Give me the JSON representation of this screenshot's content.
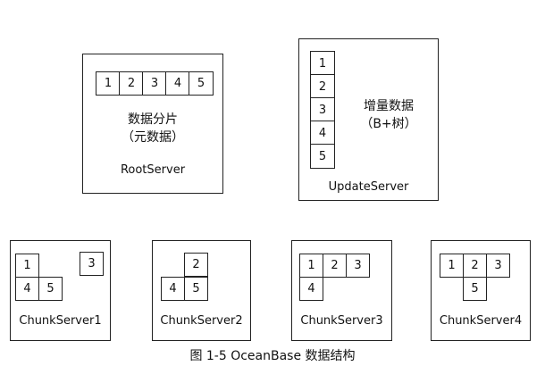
{
  "root_server": {
    "cells": [
      "1",
      "2",
      "3",
      "4",
      "5"
    ],
    "desc_line1": "数据分片",
    "desc_line2": "（元数据）",
    "label": "RootServer"
  },
  "update_server": {
    "cells": [
      "1",
      "2",
      "3",
      "4",
      "5"
    ],
    "desc_line1": "增量数据",
    "desc_line2": "（B+树）",
    "label": "UpdateServer"
  },
  "chunk_servers": [
    {
      "label": "ChunkServer1",
      "cells": [
        "1",
        "3",
        "4",
        "5"
      ]
    },
    {
      "label": "ChunkServer2",
      "cells": [
        "2",
        "4",
        "5"
      ]
    },
    {
      "label": "ChunkServer3",
      "cells": [
        "1",
        "2",
        "3",
        "4"
      ]
    },
    {
      "label": "ChunkServer4",
      "cells": [
        "1",
        "2",
        "3",
        "5"
      ]
    }
  ],
  "caption": "图 1-5 OceanBase 数据结构"
}
